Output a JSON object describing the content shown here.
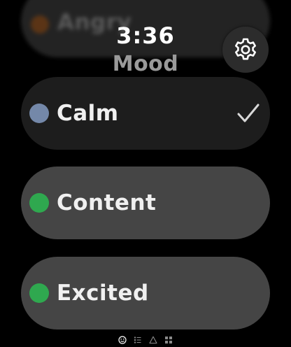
{
  "status": {
    "time": "3:36"
  },
  "header": {
    "title": "Mood"
  },
  "colors": {
    "calm": "#7488a9",
    "content": "#2fa84f",
    "excited": "#2fa84f",
    "angry": "#b55a12"
  },
  "moods": {
    "previous": {
      "label": "Angry"
    },
    "items": [
      {
        "label": "Calm",
        "selected": true
      },
      {
        "label": "Content",
        "selected": false
      },
      {
        "label": "Excited",
        "selected": false
      }
    ]
  },
  "page_indicator": {
    "icons": [
      "smiley-icon",
      "list-icon",
      "warning-icon",
      "grid-icon"
    ],
    "active_index": 0
  }
}
